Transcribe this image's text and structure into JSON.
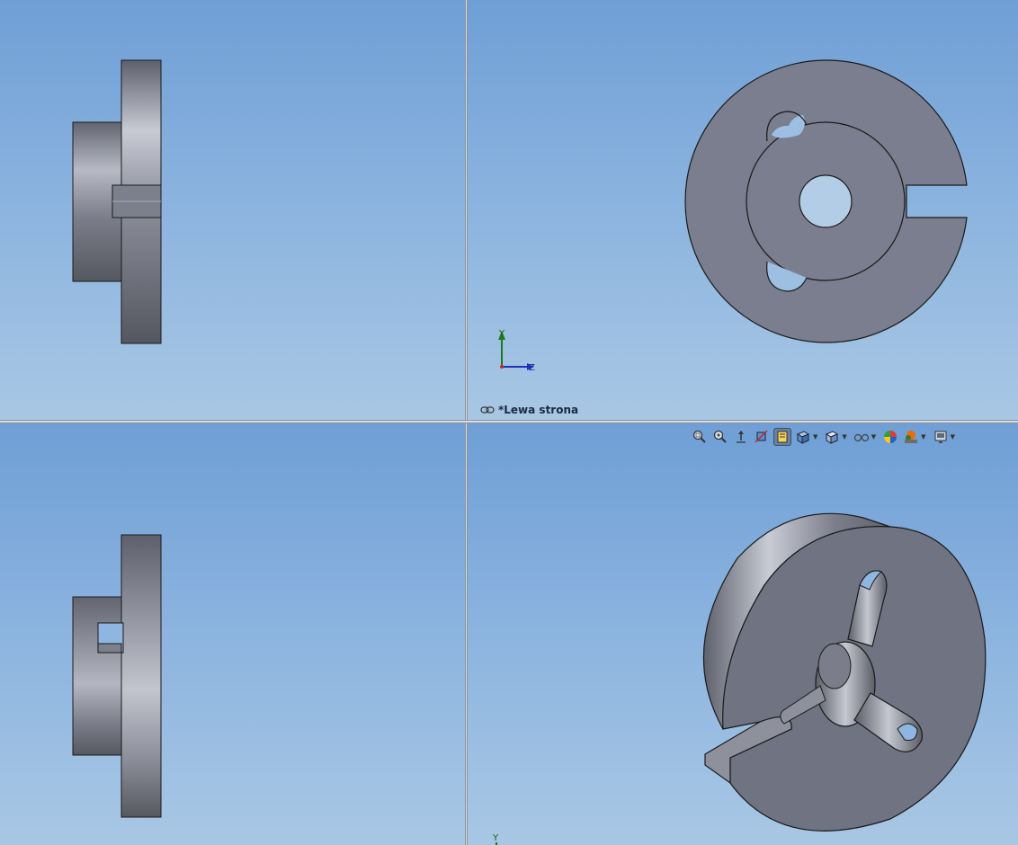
{
  "viewports": {
    "top_left": {
      "name": "side-view-top"
    },
    "top_right": {
      "name": "front-view",
      "label": "*Lewa strona",
      "triad": {
        "y": "Y",
        "z": "Z"
      }
    },
    "bottom_left": {
      "name": "side-view-bottom"
    },
    "bottom_right": {
      "name": "isometric-view",
      "triad": {
        "y": "Y"
      }
    }
  },
  "toolbar": {
    "buttons": [
      {
        "id": "zoom-to-fit",
        "icon": "zoom-fit-icon"
      },
      {
        "id": "zoom-to-area",
        "icon": "zoom-area-icon"
      },
      {
        "id": "previous-view",
        "icon": "previous-view-icon"
      },
      {
        "id": "section-view",
        "icon": "section-view-icon"
      },
      {
        "id": "dynamic-annotation",
        "icon": "annotation-view-icon",
        "active": true
      },
      {
        "id": "view-orientation",
        "icon": "view-orientation-icon",
        "dropdown": true
      },
      {
        "id": "display-style",
        "icon": "display-style-icon",
        "dropdown": true
      },
      {
        "id": "hide-show",
        "icon": "hide-show-icon",
        "dropdown": true
      },
      {
        "id": "edit-appearance",
        "icon": "appearance-icon"
      },
      {
        "id": "apply-scene",
        "icon": "scene-icon",
        "dropdown": true
      },
      {
        "id": "view-settings",
        "icon": "view-settings-icon",
        "dropdown": true
      }
    ]
  },
  "colors": {
    "part_face": "#7a7f8e",
    "part_edge": "#1a1a1a",
    "bg_top": "#6f9fd6",
    "bg_bottom": "#a8c7e4"
  }
}
